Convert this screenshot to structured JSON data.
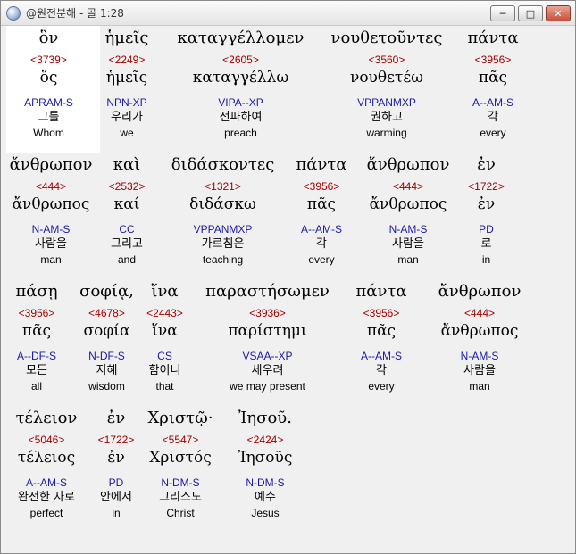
{
  "window": {
    "title": "@원전분해 - 골 1:28",
    "minimize_label": "─",
    "maximize_label": "□",
    "close_label": "✕"
  },
  "words": [
    {
      "surface": "ὃν",
      "strong": "<3739>",
      "lemma": "ὅς",
      "parse": "APRAM-S",
      "korean": "그를",
      "english": "Whom"
    },
    {
      "surface": "ἡμεῖς",
      "strong": "<2249>",
      "lemma": "ἡμεῖς",
      "parse": "NPN-XP",
      "korean": "우리가",
      "english": "we"
    },
    {
      "surface": "καταγγέλλομεν",
      "strong": "<2605>",
      "lemma": "καταγγέλλω",
      "parse": "VIPA--XP",
      "korean": "전파하여",
      "english": "preach"
    },
    {
      "surface": "νουθετοῦντες",
      "strong": "<3560>",
      "lemma": "νουθετέω",
      "parse": "VPPANMXP",
      "korean": "권하고",
      "english": "warming"
    },
    {
      "surface": "πάντα",
      "strong": "<3956>",
      "lemma": "πᾶς",
      "parse": "A--AM-S",
      "korean": "각",
      "english": "every"
    },
    {
      "surface": "ἄνθρωπον",
      "strong": "<444>",
      "lemma": "ἄνθρωπος",
      "parse": "N-AM-S",
      "korean": "사람을",
      "english": "man"
    },
    {
      "surface": "καὶ",
      "strong": "<2532>",
      "lemma": "καί",
      "parse": "CC",
      "korean": "그리고",
      "english": "and"
    },
    {
      "surface": "διδάσκοντες",
      "strong": "<1321>",
      "lemma": "διδάσκω",
      "parse": "VPPANMXP",
      "korean": "가르침은",
      "english": "teaching"
    },
    {
      "surface": "πάντα",
      "strong": "<3956>",
      "lemma": "πᾶς",
      "parse": "A--AM-S",
      "korean": "각",
      "english": "every"
    },
    {
      "surface": "ἄνθρωπον",
      "strong": "<444>",
      "lemma": "ἄνθρωπος",
      "parse": "N-AM-S",
      "korean": "사람을",
      "english": "man"
    },
    {
      "surface": "ἐν",
      "strong": "<1722>",
      "lemma": "ἐν",
      "parse": "PD",
      "korean": "로",
      "english": "in"
    },
    {
      "surface": "πάσῃ",
      "strong": "<3956>",
      "lemma": "πᾶς",
      "parse": "A--DF-S",
      "korean": "모든",
      "english": "all"
    },
    {
      "surface": "σοφίᾳ,",
      "strong": "<4678>",
      "lemma": "σοφία",
      "parse": "N-DF-S",
      "korean": "지혜",
      "english": "wisdom"
    },
    {
      "surface": "ἵνα",
      "strong": "<2443>",
      "lemma": "ἵνα",
      "parse": "CS",
      "korean": "함이니",
      "english": "that"
    },
    {
      "surface": "παραστήσωμεν",
      "strong": "<3936>",
      "lemma": "παρίστημι",
      "parse": "VSAA--XP",
      "korean": "세우려",
      "english": "we may present"
    },
    {
      "surface": "πάντα",
      "strong": "<3956>",
      "lemma": "πᾶς",
      "parse": "A--AM-S",
      "korean": "각",
      "english": "every"
    },
    {
      "surface": "ἄνθρωπον",
      "strong": "<444>",
      "lemma": "ἄνθρωπος",
      "parse": "N-AM-S",
      "korean": "사람을",
      "english": "man"
    },
    {
      "surface": "τέλειον",
      "strong": "<5046>",
      "lemma": "τέλειος",
      "parse": "A--AM-S",
      "korean": "완전한 자로",
      "english": "perfect"
    },
    {
      "surface": "ἐν",
      "strong": "<1722>",
      "lemma": "ἐν",
      "parse": "PD",
      "korean": "안에서",
      "english": "in"
    },
    {
      "surface": "Χριστῷ·",
      "strong": "<5547>",
      "lemma": "Χριστός",
      "parse": "N-DM-S",
      "korean": "그리스도",
      "english": "Christ"
    },
    {
      "surface": "Ἰησοῦ.",
      "strong": "<2424>",
      "lemma": "Ἰησοῦς",
      "parse": "N-DM-S",
      "korean": "예수",
      "english": "Jesus"
    }
  ]
}
